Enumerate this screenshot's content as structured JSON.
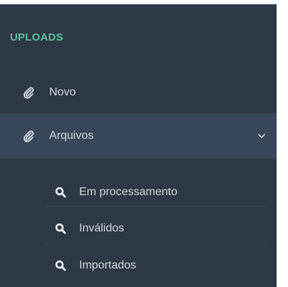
{
  "sidebar": {
    "section_title": "UPLOADS",
    "items": [
      {
        "label": "Novo",
        "icon": "paperclip-icon"
      },
      {
        "label": "Arquivos",
        "icon": "paperclip-icon",
        "expanded": true,
        "chevron": "chevron-down-icon"
      }
    ],
    "submenu": [
      {
        "label": "Em processamento",
        "icon": "search-icon"
      },
      {
        "label": "Inválidos",
        "icon": "search-icon"
      },
      {
        "label": "Importados",
        "icon": "search-icon"
      }
    ]
  },
  "colors": {
    "sidebar_bg": "#2d3945",
    "active_item_bg": "#38475a",
    "section_title": "#5fbf9f",
    "text": "#d2d8de"
  }
}
